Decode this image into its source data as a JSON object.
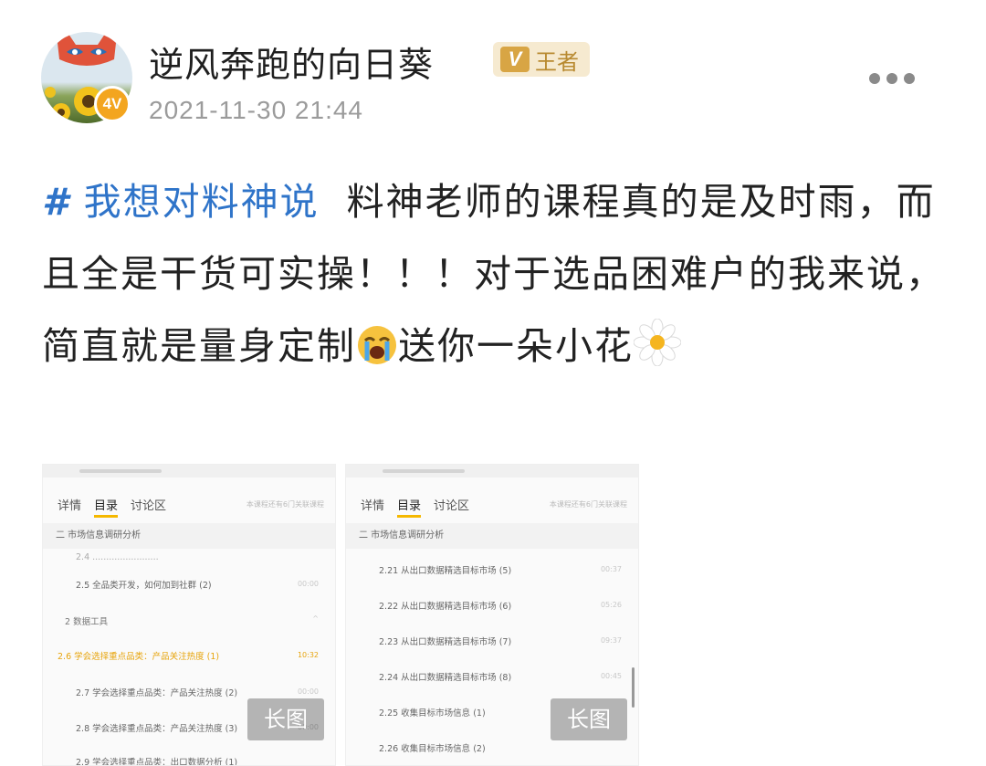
{
  "post": {
    "author": {
      "name": "逆风奔跑的向日葵",
      "avatar_badge": "4V",
      "vip_mark": "V",
      "vip_label": "王者"
    },
    "timestamp": "2021-11-30 21:44",
    "topic_hash": "#",
    "topic": "我想对料神说",
    "text_part1": "料神老师的课程真的是及时雨，而且全是干货可实操！！！对于选品困难户的我来说，简直就是量身定制",
    "emoji_cry": "loudly-crying-face-icon",
    "text_part2": "送你一朵小花",
    "emoji_flower": "daisy-icon"
  },
  "images": [
    {
      "long_tag": "长图",
      "tabs": [
        "详情",
        "目录",
        "讨论区"
      ],
      "tab_hint": "本课程还有6门关联课程",
      "section": "二  市场信息调研分析",
      "rows": [
        {
          "text": "2.4 ........................",
          "dur": ""
        },
        {
          "text": "2.5 全品类开发，如何加到社群 (2)",
          "dur": "00:00"
        },
        {
          "text": "2  数据工具",
          "dur": "^"
        },
        {
          "text": "2.6 学会选择重点品类：产品关注热度 (1)",
          "dur": "10:32"
        },
        {
          "text": "2.7 学会选择重点品类：产品关注热度 (2)",
          "dur": "00:00"
        },
        {
          "text": "2.8 学会选择重点品类：产品关注热度 (3)",
          "dur": "00:00"
        },
        {
          "text": "2.9 学会选择重点品类：出口数据分析 (1)",
          "dur": ""
        }
      ]
    },
    {
      "long_tag": "长图",
      "tabs": [
        "详情",
        "目录",
        "讨论区"
      ],
      "tab_hint": "本课程还有6门关联课程",
      "section": "二  市场信息调研分析",
      "rows": [
        {
          "text": "2.21 从出口数据精选目标市场 (5)",
          "dur": "00:37"
        },
        {
          "text": "2.22 从出口数据精选目标市场 (6)",
          "dur": "05:26"
        },
        {
          "text": "2.23 从出口数据精选目标市场 (7)",
          "dur": "09:37"
        },
        {
          "text": "2.24 从出口数据精选目标市场 (8)",
          "dur": "00:45"
        },
        {
          "text": "2.25 收集目标市场信息 (1)",
          "dur": ""
        },
        {
          "text": "2.26 收集目标市场信息 (2)",
          "dur": ""
        }
      ]
    }
  ]
}
